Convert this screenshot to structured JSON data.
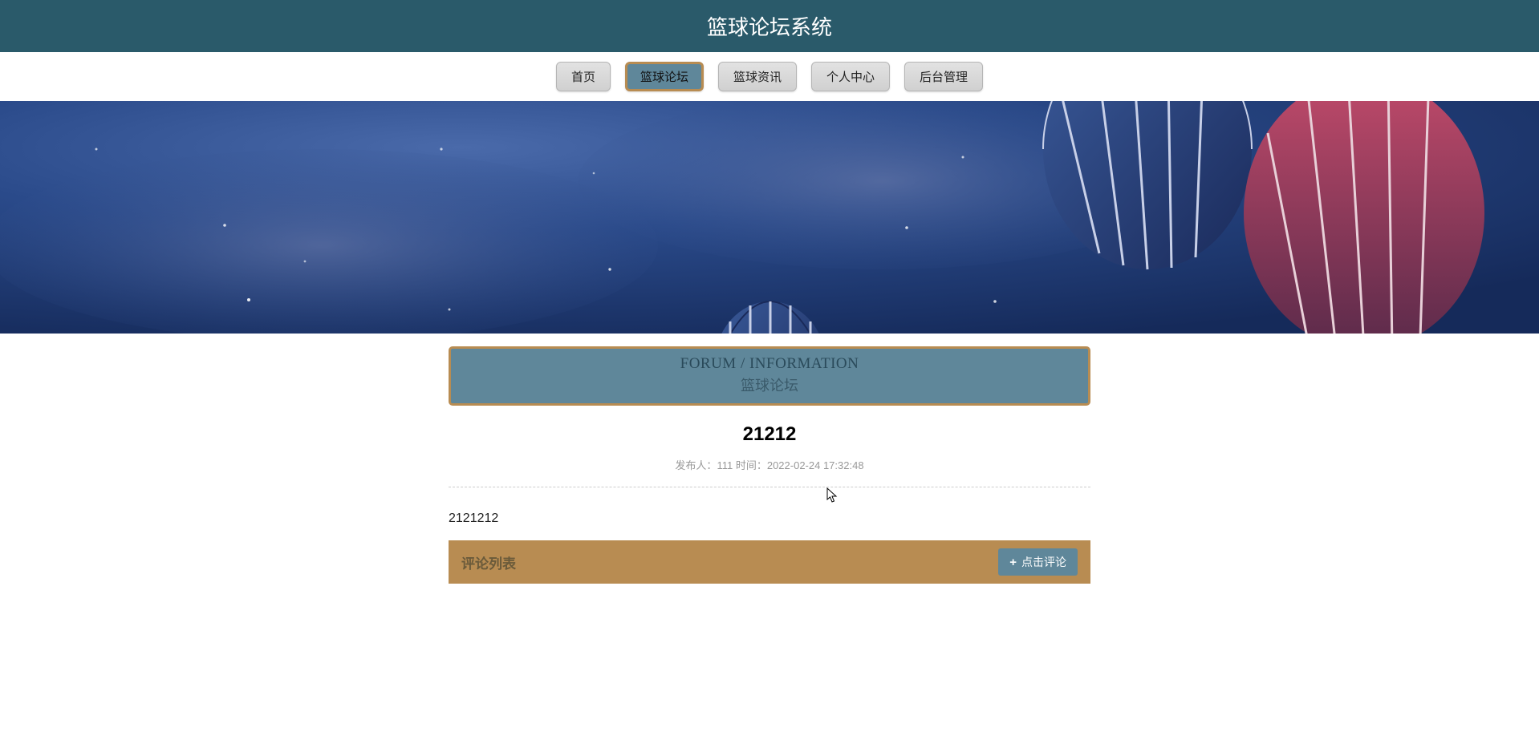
{
  "header": {
    "title": "篮球论坛系统"
  },
  "nav": {
    "items": [
      {
        "label": "首页",
        "active": false
      },
      {
        "label": "篮球论坛",
        "active": true
      },
      {
        "label": "篮球资讯",
        "active": false
      },
      {
        "label": "个人中心",
        "active": false
      },
      {
        "label": "后台管理",
        "active": false
      }
    ]
  },
  "section": {
    "en": "FORUM / INFORMATION",
    "cn": "篮球论坛"
  },
  "post": {
    "title": "21212",
    "meta_publisher_label": "发布人：",
    "meta_publisher": "111",
    "meta_time_label": "时间：",
    "meta_time": "2022-02-24 17:32:48",
    "body": "2121212"
  },
  "comments": {
    "header_label": "评论列表",
    "add_button": "点击评论"
  }
}
